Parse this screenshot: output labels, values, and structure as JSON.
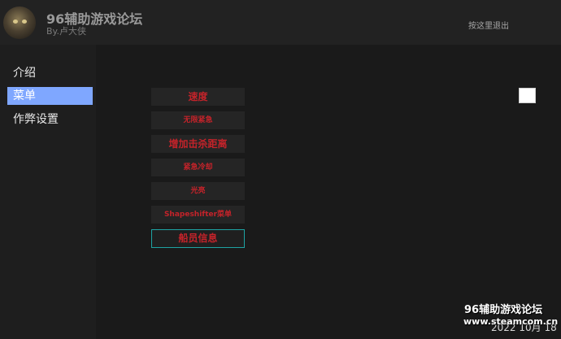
{
  "header": {
    "title": "96辅助游戏论坛",
    "subtitle": "By.卢大侠",
    "logout_label": "按这里退出"
  },
  "sidebar": {
    "items": [
      {
        "label": "介绍",
        "active": false
      },
      {
        "label": "菜单",
        "active": true
      },
      {
        "label": "作弊设置",
        "active": false
      }
    ]
  },
  "menu": {
    "buttons": [
      {
        "label": "速度"
      },
      {
        "label": "无限紧急"
      },
      {
        "label": "增加击杀距离"
      },
      {
        "label": "紧急冷却"
      },
      {
        "label": "光亮"
      },
      {
        "label": "Shapeshifter菜单"
      },
      {
        "label": "船员信息",
        "selected": true
      }
    ]
  },
  "watermark": {
    "line1": "96辅助游戏论坛",
    "line2": "www.steamcom.cn"
  },
  "date_text": "2022  10月  18",
  "colors": {
    "accent_nav": "#7fa7ff",
    "button_text": "#c4232a",
    "selected_border": "#1ea3a3"
  }
}
